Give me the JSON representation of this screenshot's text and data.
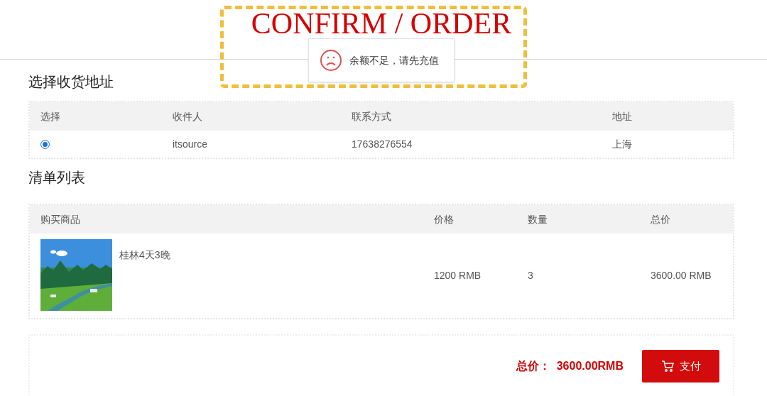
{
  "page": {
    "title": "CONFIRM / ORDER"
  },
  "toast": {
    "message": "余额不足，请先充值"
  },
  "address_section": {
    "title": "选择收货地址",
    "columns": [
      "选择",
      "收件人",
      "联系方式",
      "地址"
    ],
    "rows": [
      {
        "cells": [
          {
            "kind": "radio",
            "selected": true
          },
          {
            "kind": "text",
            "text": "itsource"
          },
          {
            "kind": "text",
            "text": "17638276554"
          },
          {
            "kind": "text",
            "text": "上海"
          }
        ]
      }
    ]
  },
  "cart_section": {
    "title": "清单列表",
    "columns": [
      "购买商品",
      "价格",
      "数量",
      "总价"
    ],
    "rows": [
      {
        "name": "桂林4天3晚",
        "price": "1200 RMB",
        "quantity": "3",
        "total": "3600.00 RMB"
      }
    ]
  },
  "footer": {
    "total": "总价：  3600.00RMB",
    "pay_button": "支付"
  }
}
